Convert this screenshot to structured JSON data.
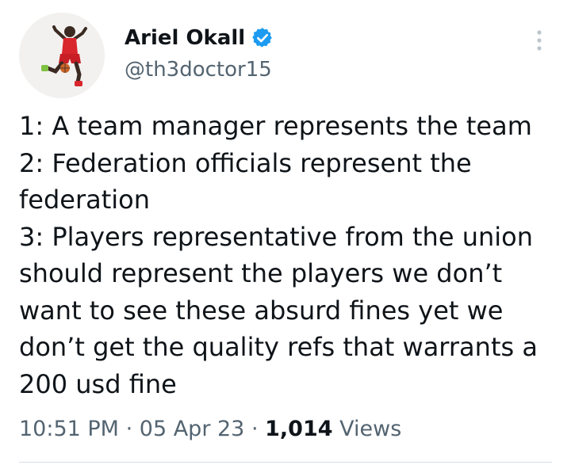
{
  "author": {
    "display_name": "Ariel Okall",
    "handle": "@th3doctor15",
    "verified": true
  },
  "tweet": {
    "lines": [
      "1: A team manager represents the team",
      "2: Federation officials represent the",
      "federation",
      "3: Players representative from the union",
      "should represent the players we don’t",
      "want to see these absurd fines yet we",
      "don’t get the quality refs that warrants a",
      "200 usd fine"
    ]
  },
  "meta": {
    "time": "10:51 PM",
    "separator": "·",
    "date": "05 Apr 23",
    "views_count": "1,014",
    "views_label": "Views"
  },
  "icons": {
    "verified": "verified-badge-icon",
    "more": "more-options-icon"
  },
  "colors": {
    "text_primary": "#0f1419",
    "text_secondary": "#536471",
    "verified_blue": "#1d9bf0",
    "divider": "#d6dde2"
  }
}
